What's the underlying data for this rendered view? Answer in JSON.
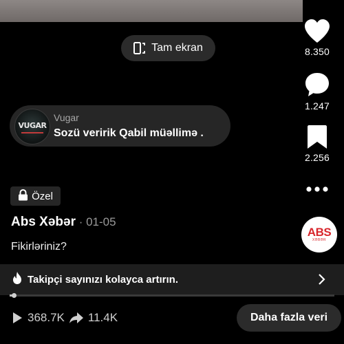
{
  "video": {
    "fullscreen_label": "Tam ekran",
    "progress": 0.008
  },
  "actions": {
    "likes": "8.350",
    "comments": "1.247",
    "saves": "2.256"
  },
  "comment": {
    "author": "Vugar",
    "text": "Sozü veririk Qabil müəllimə .",
    "avatar_text": "VUGAR"
  },
  "post": {
    "visibility": "Özel",
    "author": "Abs Xəbər",
    "date": "01-05",
    "caption": "Fikirləriniz?",
    "brand_logo": "ABS",
    "brand_sub": "XƏBƏR"
  },
  "promo": {
    "text": "Takipçi sayınızı kolayca artırın."
  },
  "stats": {
    "views": "368.7K",
    "shares": "11.4K",
    "more_label": "Daha fazla veri"
  },
  "colors": {
    "background": "#000000",
    "panel": "#262626",
    "brand_red": "#d8252b"
  }
}
